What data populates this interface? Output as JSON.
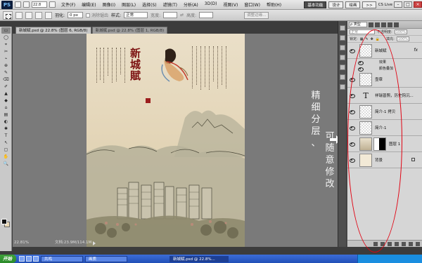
{
  "app": {
    "logo": "PS",
    "zoom": "22.8"
  },
  "menu": [
    "文件(F)",
    "编辑(E)",
    "图像(I)",
    "图层(L)",
    "选择(S)",
    "滤镜(T)",
    "分析(A)",
    "3D(D)",
    "视图(V)",
    "窗口(W)",
    "帮助(H)"
  ],
  "workspace": {
    "essentials": "基本功能",
    "design": "设计",
    "paint": "绘画",
    "more": ">>",
    "cslive": "CS Live"
  },
  "options": {
    "feather_label": "羽化:",
    "feather_value": "0 px",
    "antialias": "消除锯齿",
    "style_label": "样式:",
    "style_value": "正常",
    "refine_edge": "调整边缘..."
  },
  "tabs": [
    "新城赋.psd @ 22.8% (图层 6, RGB/8)",
    "新城赋.psd @ 22.8% (图层 1, RGB/8)"
  ],
  "tools": [
    "▭",
    "◯",
    "⌖",
    "✂",
    "⌁",
    "⊕",
    "✎",
    "⌫",
    "✐",
    "▲",
    "◆",
    "⌂",
    "▤",
    "◐",
    "✱",
    "T",
    "↖",
    "▢",
    "✋",
    "🔍"
  ],
  "document": {
    "title_chars": [
      "新",
      "城",
      "賦"
    ]
  },
  "status": {
    "zoom": "22.81%",
    "doc": "文档:23.9M/114.1M"
  },
  "annotation": {
    "col1": [
      "精",
      "细",
      "分",
      "层",
      "、"
    ],
    "col2": [
      "可",
      "随",
      "意",
      "修",
      "改"
    ]
  },
  "layers_panel": {
    "filter": "ρ 类型",
    "blend": "正常",
    "opacity_label": "不透明度:",
    "opacity": "100%",
    "lock_label": "锁定:",
    "fill_label": "填充:",
    "fill": "100%",
    "layers": [
      {
        "name": "新城赋",
        "fx": "fx",
        "thumb": "checker"
      },
      {
        "name": "效果",
        "sub": true
      },
      {
        "name": "颜色叠加",
        "sub": true
      },
      {
        "name": "壶章",
        "thumb": "checker"
      },
      {
        "name": "祥瑞普照，历史钩沉...",
        "thumb": "text"
      },
      {
        "name": "简介-1 拷贝",
        "thumb": "checker"
      },
      {
        "name": "简介-1",
        "thumb": "checker"
      },
      {
        "name": "图层 1",
        "thumb": "photo"
      },
      {
        "name": "背景",
        "thumb": "cream"
      }
    ]
  },
  "colors": {
    "accent_oval": "#e10010",
    "seal": "#9c1d1d",
    "title_red": "#7b1010"
  },
  "taskbar": {
    "start": "开始",
    "tasks": [
      "共鸣",
      "画质",
      "新城赋.psd @ 22.8%..."
    ]
  }
}
